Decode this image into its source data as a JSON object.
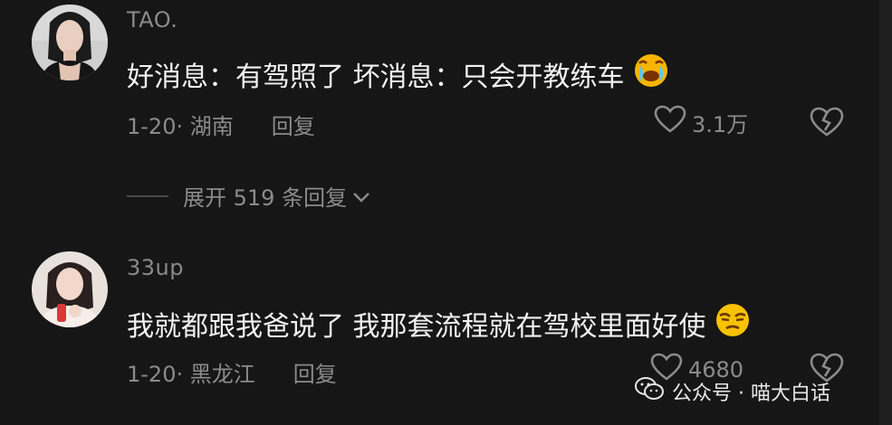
{
  "comments": [
    {
      "username": "TAO.",
      "text": "好消息：有驾照了  坏消息：只会开教练车",
      "emoji": "crying-face-emoji",
      "date_location": "1-20· 湖南",
      "reply_label": "回复",
      "like_count": "3.1万"
    },
    {
      "username": "33up",
      "text": "我就都跟我爸说了 我那套流程就在驾校里面好使",
      "emoji": "smug-face-emoji",
      "date_location": "1-20· 黑龙江",
      "reply_label": "回复",
      "like_count": "4680"
    }
  ],
  "expand_replies": {
    "label": "展开 519 条回复"
  },
  "watermark": {
    "text": "公众号 · 喵大白话"
  }
}
